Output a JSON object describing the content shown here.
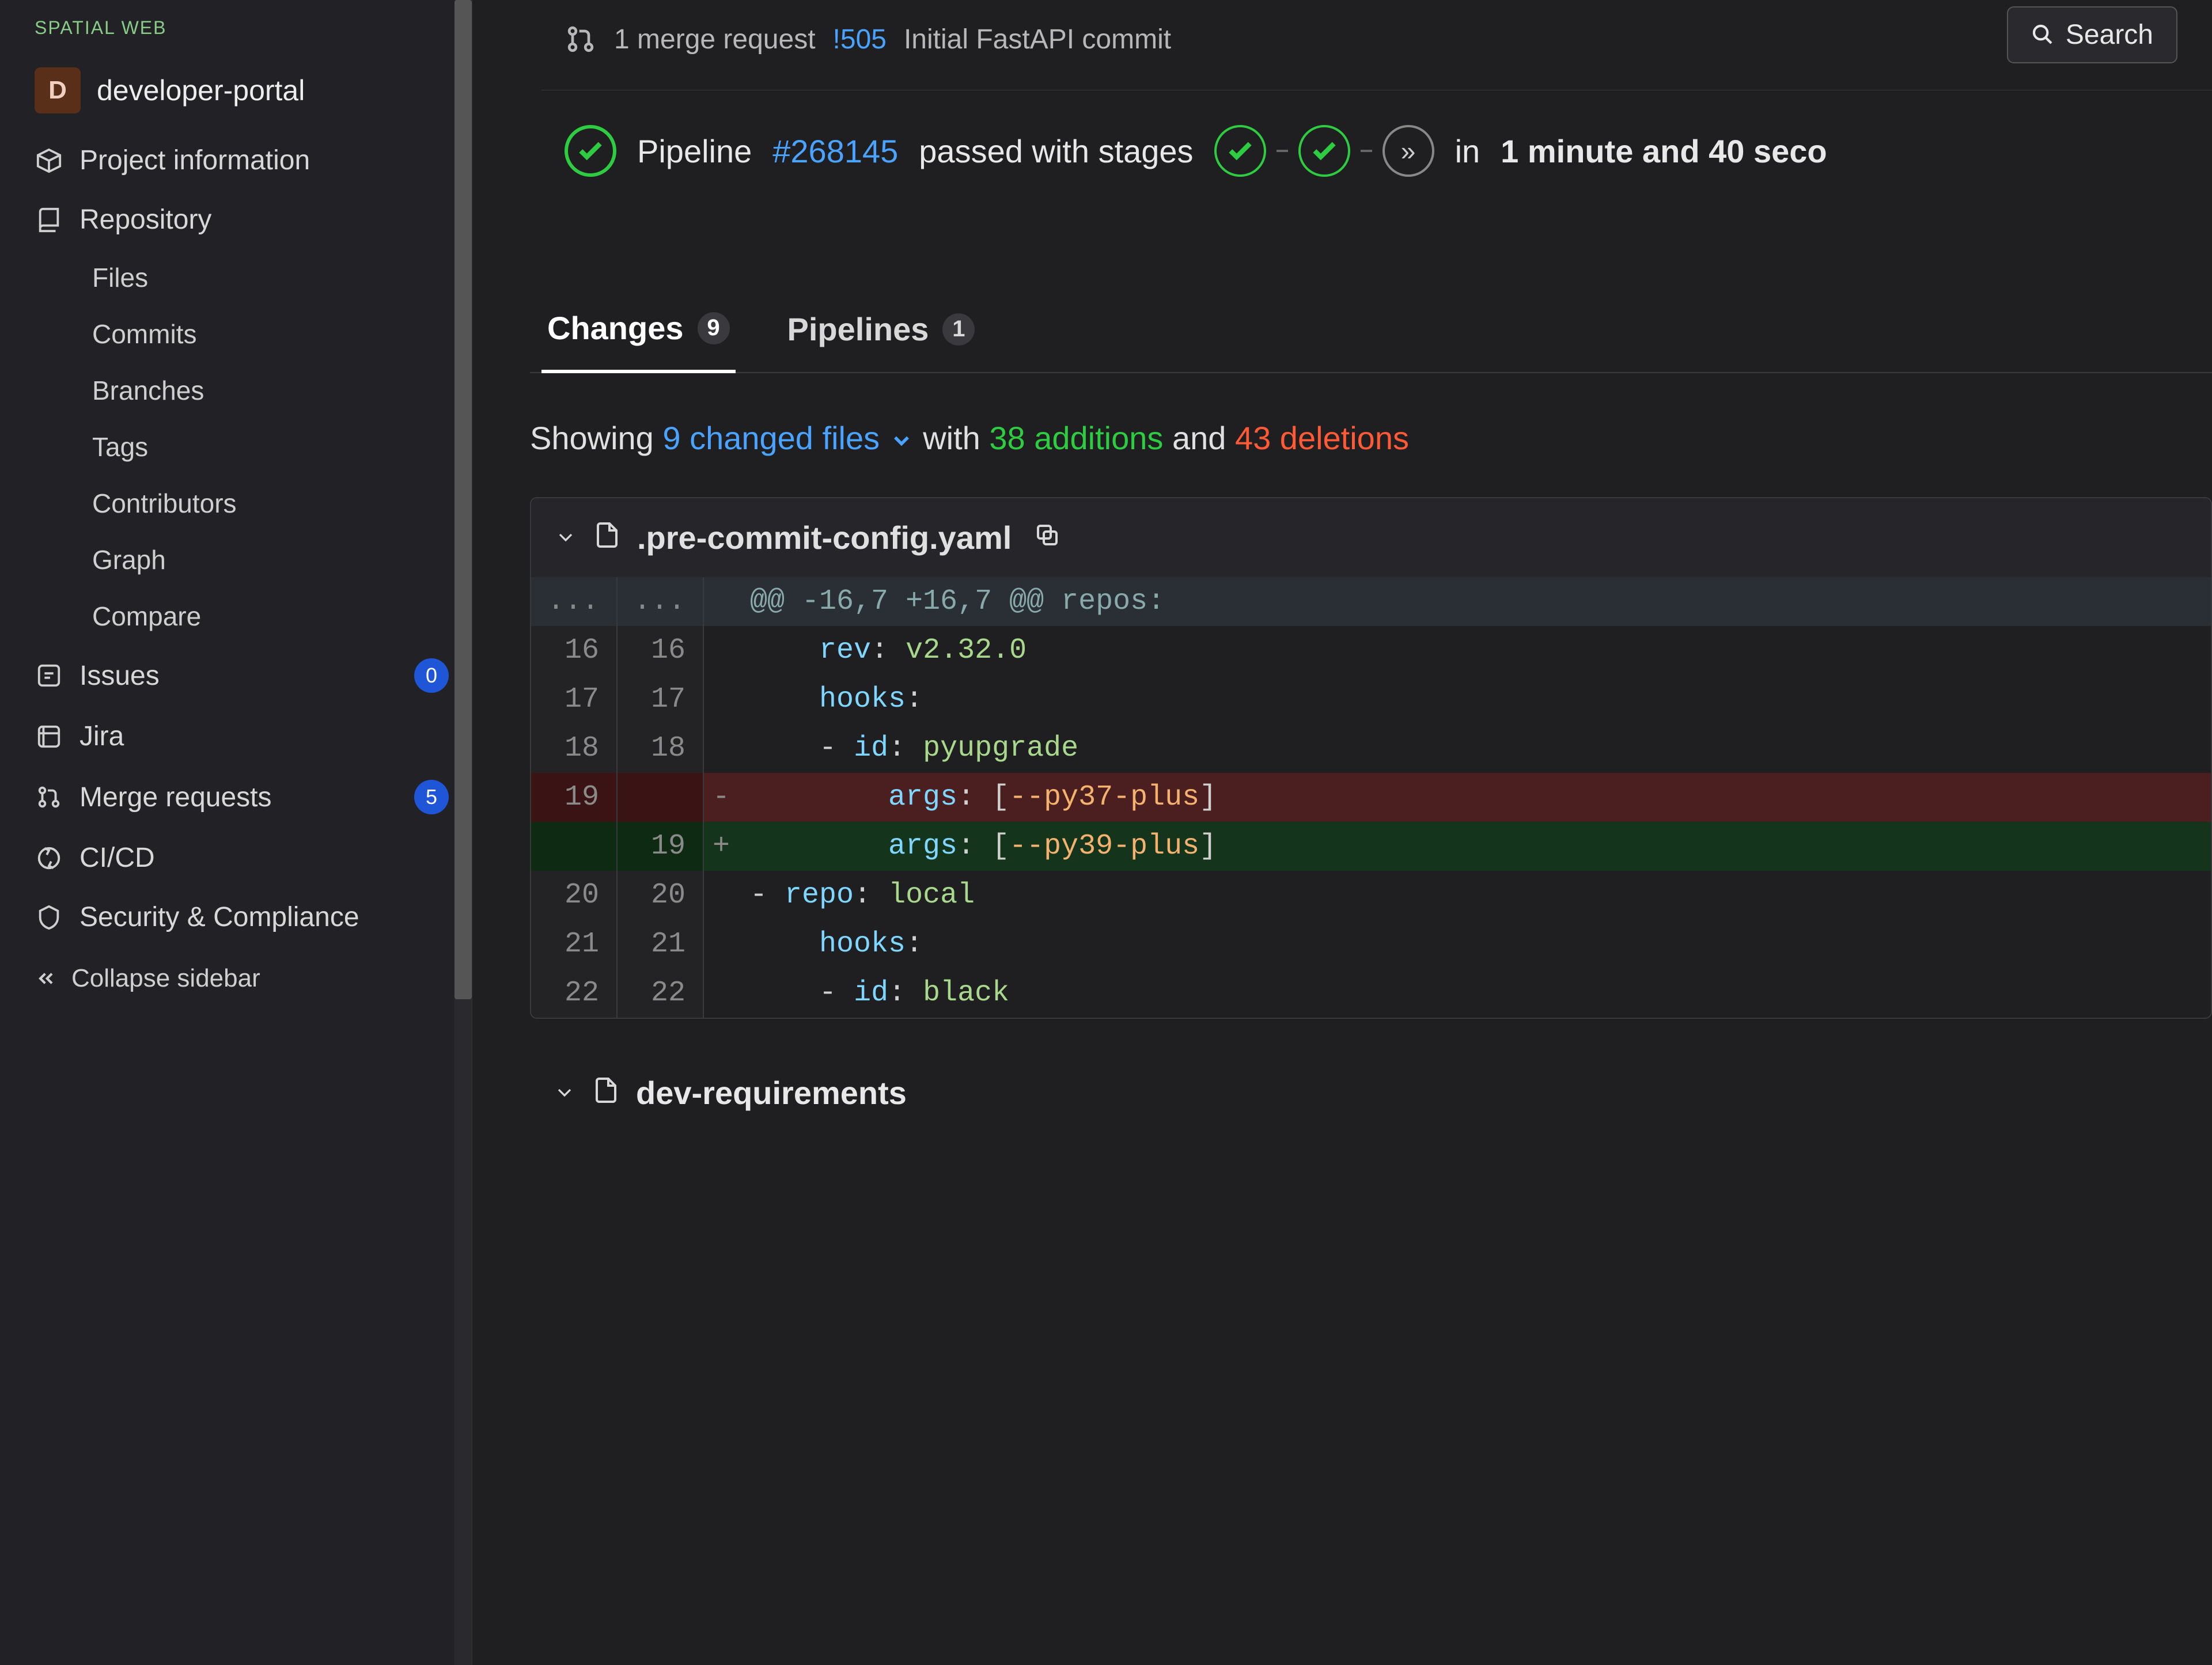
{
  "brand": "SPATIAL WEB",
  "project": {
    "initial": "D",
    "name": "developer-portal"
  },
  "topbar": {
    "search_label": "Search"
  },
  "sidebar": {
    "info": "Project information",
    "repo": "Repository",
    "repo_items": {
      "files": "Files",
      "commits": "Commits",
      "branches": "Branches",
      "tags": "Tags",
      "contributors": "Contributors",
      "graph": "Graph",
      "compare": "Compare"
    },
    "issues": {
      "label": "Issues",
      "count": "0"
    },
    "jira": "Jira",
    "merge_requests": {
      "label": "Merge requests",
      "count": "5"
    },
    "cicd": "CI/CD",
    "security": "Security & Compliance",
    "collapse": "Collapse sidebar"
  },
  "mr": {
    "prefix": "1 merge request",
    "id": "!505",
    "title": "Initial FastAPI commit"
  },
  "pipeline": {
    "label": "Pipeline",
    "id": "#268145",
    "status": "passed with stages",
    "in": "in",
    "duration": "1 minute and 40 seco"
  },
  "tabs": {
    "changes": {
      "label": "Changes",
      "count": "9"
    },
    "pipelines": {
      "label": "Pipelines",
      "count": "1"
    }
  },
  "showing": {
    "prefix": "Showing",
    "files": "9 changed files",
    "with": "with",
    "additions": "38 additions",
    "and": "and",
    "deletions": "43 deletions"
  },
  "file1": {
    "name": ".pre-commit-config.yaml",
    "hunk": "@@ -16,7 +16,7 @@ repos:",
    "rows": [
      {
        "old": "16",
        "new": "16",
        "kind": "ctx",
        "sign": "",
        "code_html": "    <span class='tok-key'>rev</span><span class='tok-pun'>:</span> <span class='tok-str'>v2.32.0</span>"
      },
      {
        "old": "17",
        "new": "17",
        "kind": "ctx",
        "sign": "",
        "code_html": "    <span class='tok-key'>hooks</span><span class='tok-pun'>:</span>"
      },
      {
        "old": "18",
        "new": "18",
        "kind": "ctx",
        "sign": "",
        "code_html": "    <span class='tok-pun'>-</span> <span class='tok-key'>id</span><span class='tok-pun'>:</span> <span class='tok-str'>pyupgrade</span>"
      },
      {
        "old": "19",
        "new": "",
        "kind": "del",
        "sign": "-",
        "code_html": "        <span class='tok-key'>args</span><span class='tok-pun'>:</span> <span class='tok-pun'>[</span><span class='tok-flag'>--py37-plus</span><span class='tok-pun'>]</span>"
      },
      {
        "old": "",
        "new": "19",
        "kind": "add",
        "sign": "+",
        "code_html": "        <span class='tok-key'>args</span><span class='tok-pun'>:</span> <span class='tok-pun'>[</span><span class='tok-flag'>--py39-plus</span><span class='tok-pun'>]</span>"
      },
      {
        "old": "20",
        "new": "20",
        "kind": "ctx",
        "sign": "",
        "code_html": "<span class='tok-pun'>-</span> <span class='tok-key'>repo</span><span class='tok-pun'>:</span> <span class='tok-str'>local</span>"
      },
      {
        "old": "21",
        "new": "21",
        "kind": "ctx",
        "sign": "",
        "code_html": "    <span class='tok-key'>hooks</span><span class='tok-pun'>:</span>"
      },
      {
        "old": "22",
        "new": "22",
        "kind": "ctx",
        "sign": "",
        "code_html": "    <span class='tok-pun'>-</span> <span class='tok-key'>id</span><span class='tok-pun'>:</span> <span class='tok-str'>black</span>"
      }
    ]
  },
  "file2": {
    "name": "dev-requirements"
  }
}
